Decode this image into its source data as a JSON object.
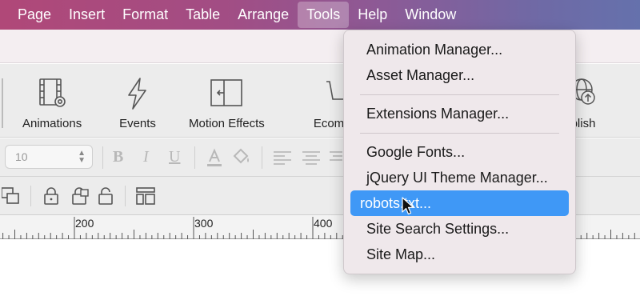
{
  "menubar": {
    "items": [
      "Page",
      "Insert",
      "Format",
      "Table",
      "Arrange",
      "Tools",
      "Help",
      "Window"
    ],
    "active": "Tools"
  },
  "toolbar": {
    "animations": "Animations",
    "events": "Events",
    "motion_effects": "Motion Effects",
    "ecommerce": "Ecom",
    "publish": "blish"
  },
  "format": {
    "font_size": "10",
    "bold": "B",
    "italic": "I",
    "underline": "U"
  },
  "ruler": {
    "marks": [
      "200",
      "300",
      "400"
    ]
  },
  "tools_menu": {
    "items": [
      "Animation Manager...",
      "Asset Manager...",
      "Extensions Manager...",
      "Google Fonts...",
      "jQuery UI Theme Manager...",
      "robots.txt...",
      "Site Search Settings...",
      "Site Map..."
    ],
    "highlighted": "robots.txt..."
  },
  "colors": {
    "highlight": "#3f98f6",
    "menu_text": "#ffffff"
  }
}
